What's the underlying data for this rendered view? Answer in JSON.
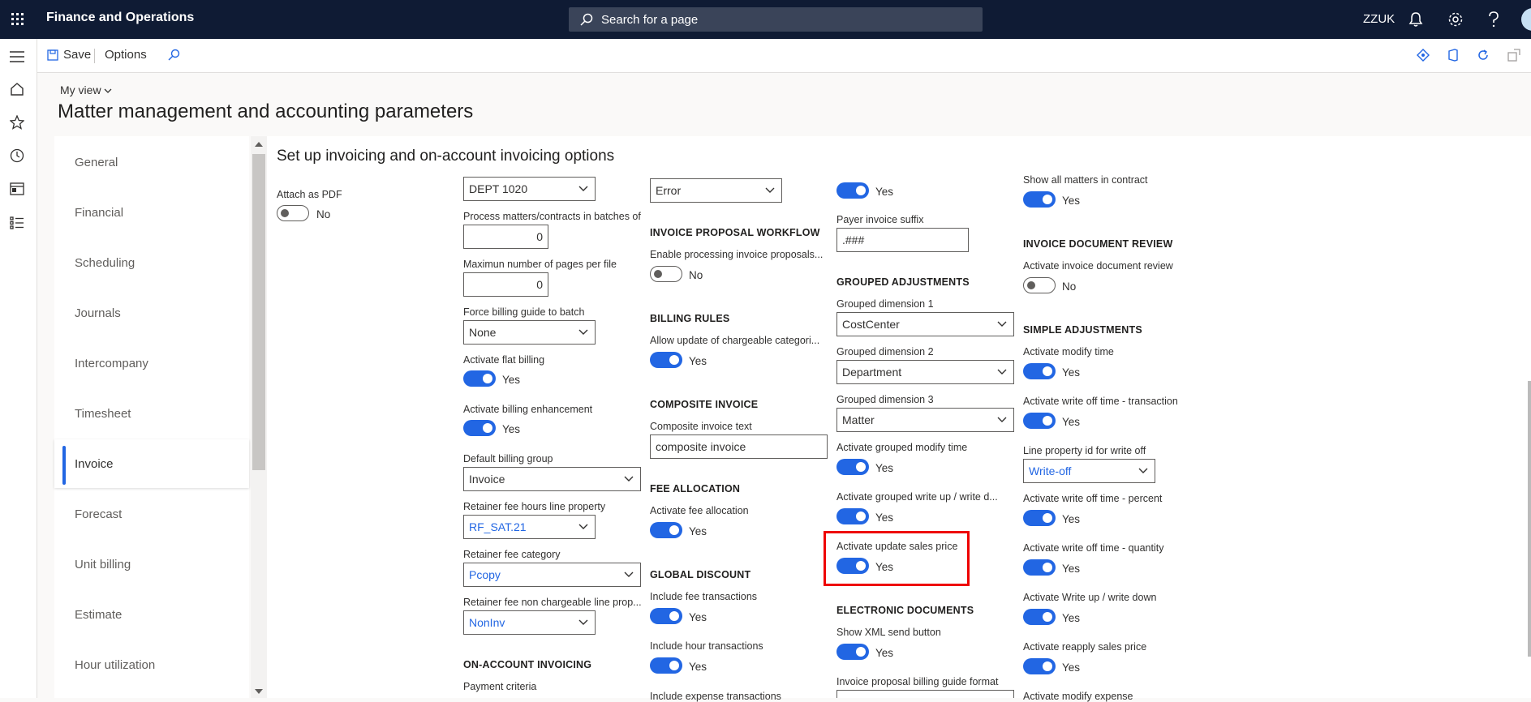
{
  "app": {
    "title": "Finance and Operations",
    "search_placeholder": "Search for a page",
    "company": "ZZUK"
  },
  "commands": {
    "save": "Save",
    "options": "Options"
  },
  "page": {
    "view": "My view",
    "title": "Matter management and accounting parameters",
    "section_title": "Set up invoicing and on-account invoicing options"
  },
  "tabs": [
    "General",
    "Financial",
    "Scheduling",
    "Journals",
    "Intercompany",
    "Timesheet",
    "Invoice",
    "Forecast",
    "Unit billing",
    "Estimate",
    "Hour utilization"
  ],
  "col1": {
    "attach_pdf": {
      "label": "Attach as PDF",
      "value": "No"
    }
  },
  "col2": {
    "dept": "DEPT 1020",
    "batches": {
      "label": "Process matters/contracts in batches of",
      "value": "0"
    },
    "max_pages": {
      "label": "Maximun number of pages per file",
      "value": "0"
    },
    "force_billing": {
      "label": "Force billing guide to batch",
      "value": "None"
    },
    "flat_billing": {
      "label": "Activate flat billing",
      "value": "Yes"
    },
    "billing_enh": {
      "label": "Activate billing enhancement",
      "value": "Yes"
    },
    "billing_group": {
      "label": "Default billing group",
      "value": "Invoice"
    },
    "retainer_hours": {
      "label": "Retainer fee hours line property",
      "value": "RF_SAT.21"
    },
    "retainer_cat": {
      "label": "Retainer fee category",
      "value": "Pcopy"
    },
    "retainer_nonchg": {
      "label": "Retainer fee non chargeable line prop...",
      "value": "NonInv"
    },
    "on_account_hdr": "ON-ACCOUNT INVOICING",
    "payment_criteria": "Payment criteria"
  },
  "col3": {
    "error_value": "Error",
    "workflow_hdr": "INVOICE PROPOSAL WORKFLOW",
    "enable_proc": {
      "label": "Enable processing invoice proposals...",
      "value": "No"
    },
    "billing_rules_hdr": "BILLING RULES",
    "allow_update": {
      "label": "Allow update of chargeable categori...",
      "value": "Yes"
    },
    "composite_hdr": "COMPOSITE INVOICE",
    "composite_text": {
      "label": "Composite invoice text",
      "value": "composite invoice"
    },
    "fee_alloc_hdr": "FEE ALLOCATION",
    "fee_alloc": {
      "label": "Activate fee allocation",
      "value": "Yes"
    },
    "global_disc_hdr": "GLOBAL DISCOUNT",
    "include_fee": {
      "label": "Include fee transactions",
      "value": "Yes"
    },
    "include_hour": {
      "label": "Include hour transactions",
      "value": "Yes"
    },
    "include_expense": "Include expense transactions"
  },
  "col4": {
    "top_toggle": "Yes",
    "payer_suffix": {
      "label": "Payer invoice suffix",
      "value": ".###"
    },
    "grouped_hdr": "GROUPED ADJUSTMENTS",
    "dim1": {
      "label": "Grouped dimension 1",
      "value": "CostCenter"
    },
    "dim2": {
      "label": "Grouped dimension 2",
      "value": "Department"
    },
    "dim3": {
      "label": "Grouped dimension 3",
      "value": "Matter"
    },
    "grouped_modify": {
      "label": "Activate grouped modify time",
      "value": "Yes"
    },
    "grouped_writeup": {
      "label": "Activate grouped write up / write d...",
      "value": "Yes"
    },
    "update_sales": {
      "label": "Activate update sales price",
      "value": "Yes"
    },
    "edocs_hdr": "ELECTRONIC DOCUMENTS",
    "xml_send": {
      "label": "Show XML send button",
      "value": "Yes"
    },
    "proposal_format": "Invoice proposal billing guide format"
  },
  "col5": {
    "show_all": {
      "label": "Show all matters in contract",
      "value": "Yes"
    },
    "doc_review_hdr": "INVOICE DOCUMENT REVIEW",
    "doc_review": {
      "label": "Activate invoice document review",
      "value": "No"
    },
    "simple_hdr": "SIMPLE ADJUSTMENTS",
    "modify_time": {
      "label": "Activate modify time",
      "value": "Yes"
    },
    "wo_trans": {
      "label": "Activate write off time - transaction",
      "value": "Yes"
    },
    "line_prop": {
      "label": "Line property id for write off",
      "value": "Write-off"
    },
    "wo_percent": {
      "label": "Activate write off time - percent",
      "value": "Yes"
    },
    "wo_qty": {
      "label": "Activate write off time - quantity",
      "value": "Yes"
    },
    "writeup": {
      "label": "Activate Write up / write down",
      "value": "Yes"
    },
    "reapply": {
      "label": "Activate reapply sales price",
      "value": "Yes"
    },
    "modify_expense": "Activate modify expense"
  }
}
